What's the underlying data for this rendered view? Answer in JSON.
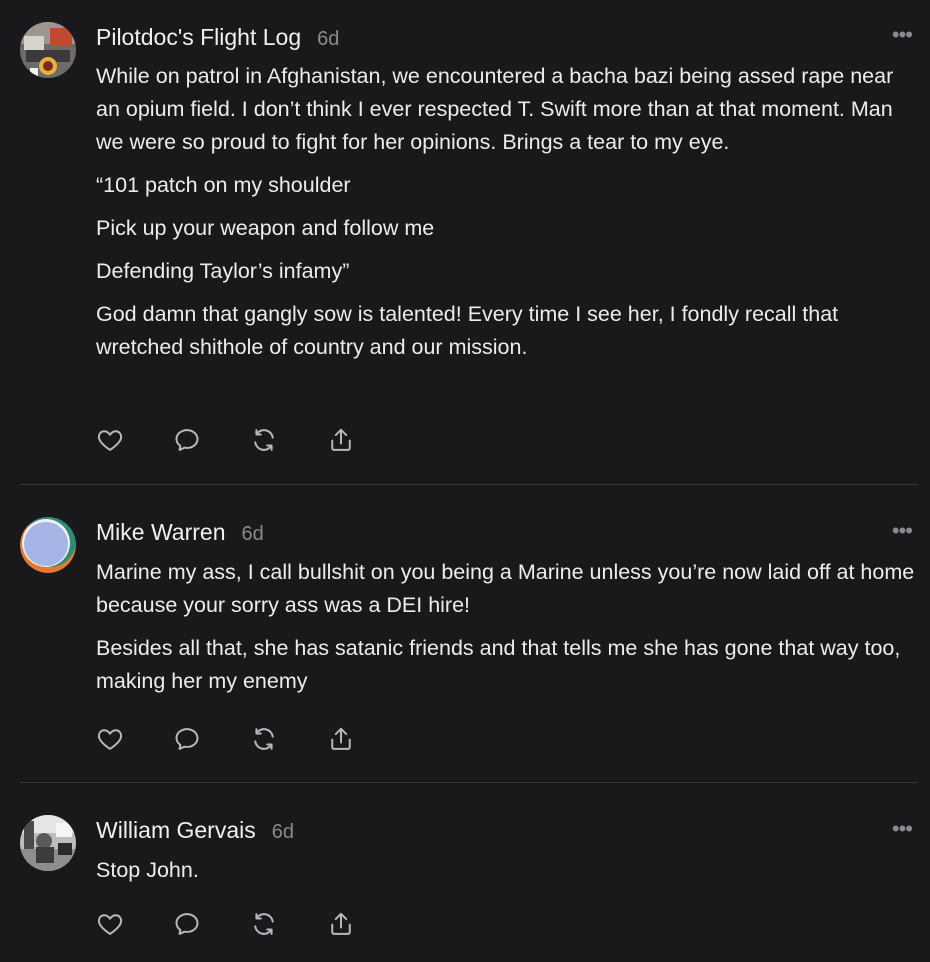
{
  "comments": [
    {
      "author": "Pilotdoc's Flight Log",
      "time": "6d",
      "more": "•••",
      "paragraphs": [
        "While on patrol in Afghanistan, we encountered a bacha bazi being assed rape near an opium field. I don’t think I ever respected T. Swift more than at that moment. Man we were so proud to fight for her opinions. Brings a tear to my eye.",
        "“101 patch on my shoulder",
        "Pick up your weapon and follow me",
        "Defending Taylor’s infamy”",
        "God damn that gangly sow is talented! Every time I see her, I fondly recall that wretched shithole of country and our mission."
      ],
      "action_icons": [
        "heart-icon",
        "comment-icon",
        "repost-icon",
        "share-icon"
      ]
    },
    {
      "author": "Mike Warren",
      "time": "6d",
      "more": "•••",
      "paragraphs": [
        "Marine my ass, I call bullshit on you being a Marine unless you’re now laid off at home because your sorry ass was a DEI hire!",
        "Besides all that, she has satanic friends and that tells me she has gone that way too, making her my enemy"
      ],
      "action_icons": [
        "heart-icon",
        "comment-icon",
        "repost-icon",
        "share-icon"
      ]
    },
    {
      "author": "William Gervais",
      "time": "6d",
      "more": "•••",
      "paragraphs": [
        "Stop John."
      ],
      "action_icons": [
        "heart-icon",
        "comment-icon",
        "repost-icon",
        "share-icon"
      ]
    }
  ],
  "colors": {
    "background": "#19191c",
    "text": "#ececec",
    "muted": "#8a8a8e",
    "divider": "#34343a"
  }
}
